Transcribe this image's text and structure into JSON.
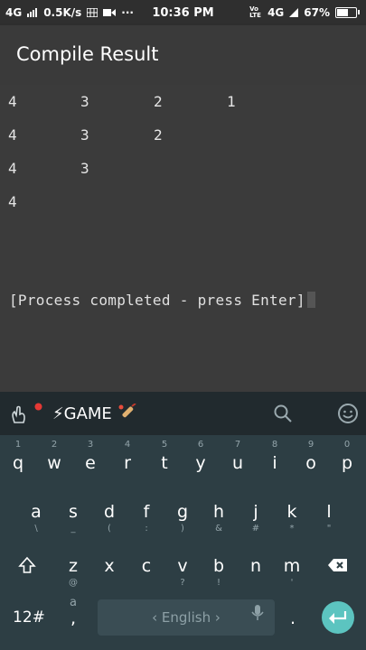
{
  "status_bar": {
    "network": "4G",
    "speed": "0.5K/s",
    "more": "···",
    "time": "10:36 PM",
    "volte": "Vo LTE",
    "network_right": "4G",
    "battery": "67%",
    "battery_level": 0.67
  },
  "app_bar": {
    "title": "Compile Result"
  },
  "output": {
    "rows": [
      [
        "4",
        "3",
        "2",
        "1"
      ],
      [
        "4",
        "3",
        "2"
      ],
      [
        "4",
        "3"
      ],
      [
        "4"
      ]
    ],
    "process_message": "[Process completed - press Enter]"
  },
  "keyboard": {
    "toolbar": {
      "game_label": "⚡GAME"
    },
    "row1": {
      "keys": [
        "q",
        "w",
        "e",
        "r",
        "t",
        "y",
        "u",
        "i",
        "o",
        "p"
      ],
      "hints": [
        "1",
        "2",
        "3",
        "4",
        "5",
        "6",
        "7",
        "8",
        "9",
        "0"
      ]
    },
    "row2": {
      "keys": [
        "a",
        "s",
        "d",
        "f",
        "g",
        "h",
        "j",
        "k",
        "l"
      ],
      "subs": [
        "\\",
        "_",
        "(",
        ":",
        ")",
        "&",
        "#",
        "*",
        "\""
      ]
    },
    "row3": {
      "keys": [
        "z",
        "x",
        "c",
        "v",
        "b",
        "n",
        "m"
      ],
      "subs": [
        "@",
        "",
        "",
        "?",
        "!",
        "",
        "'"
      ]
    },
    "bottom": {
      "num_label": "12#",
      "comma_hint": "a",
      "comma": ",",
      "space_label": "‹ English ›",
      "period": "."
    }
  },
  "colors": {
    "output_bg": "#3b3b3b",
    "keyboard_bg": "#2d3e44",
    "toolbar_bg": "#212a2e",
    "enter_accent": "#5cc4c0"
  }
}
